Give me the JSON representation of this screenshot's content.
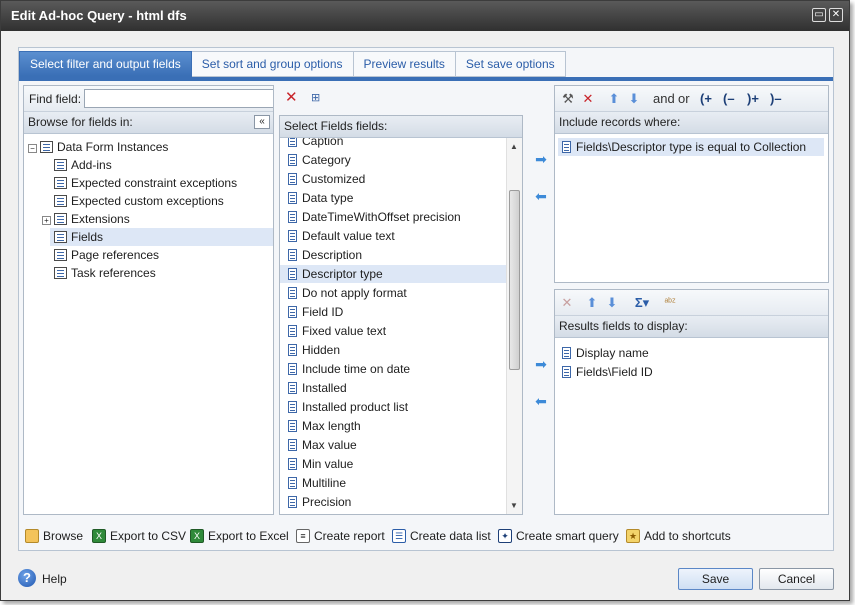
{
  "window": {
    "title": "Edit Ad-hoc Query - html dfs"
  },
  "tabs": [
    {
      "label": "Select filter and output fields"
    },
    {
      "label": "Set sort and group options"
    },
    {
      "label": "Preview results"
    },
    {
      "label": "Set save options"
    }
  ],
  "find": {
    "label": "Find field:",
    "value": ""
  },
  "browse": {
    "header": "Browse for fields in:",
    "root": "Data Form Instances",
    "items": [
      "Add-ins",
      "Expected constraint exceptions",
      "Expected custom exceptions",
      "Extensions",
      "Fields",
      "Page references",
      "Task references"
    ],
    "selected": "Fields"
  },
  "select_fields": {
    "header": "Select Fields fields:",
    "items": [
      "Caption",
      "Category",
      "Customized",
      "Data type",
      "DateTimeWithOffset precision",
      "Default value text",
      "Description",
      "Descriptor type",
      "Do not apply format",
      "Field ID",
      "Fixed value text",
      "Hidden",
      "Include time on date",
      "Installed",
      "Installed product list",
      "Max length",
      "Max value",
      "Min value",
      "Multiline",
      "Precision"
    ],
    "selected": "Descriptor type"
  },
  "filter": {
    "header": "Include records where:",
    "toolbar": {
      "and": "and",
      "or": "or",
      "open_paren_plus": "(+",
      "open_paren_minus": "(–",
      "close_paren_plus": ")+",
      "close_paren_minus": ")–"
    },
    "items": [
      "Fields\\Descriptor type is equal to Collection"
    ]
  },
  "results": {
    "header": "Results fields to display:",
    "items": [
      "Display name",
      "Fields\\Field ID"
    ]
  },
  "bottom_bar": [
    {
      "label": "Browse"
    },
    {
      "label": "Export to CSV"
    },
    {
      "label": "Export to Excel"
    },
    {
      "label": "Create report"
    },
    {
      "label": "Create data list"
    },
    {
      "label": "Create smart query"
    },
    {
      "label": "Add to shortcuts"
    }
  ],
  "footer": {
    "help": "Help",
    "save": "Save",
    "cancel": "Cancel"
  },
  "colors": {
    "accent": "#3a6fb6",
    "titlebar": "#3c3c3c",
    "selection": "#dde7f6"
  }
}
